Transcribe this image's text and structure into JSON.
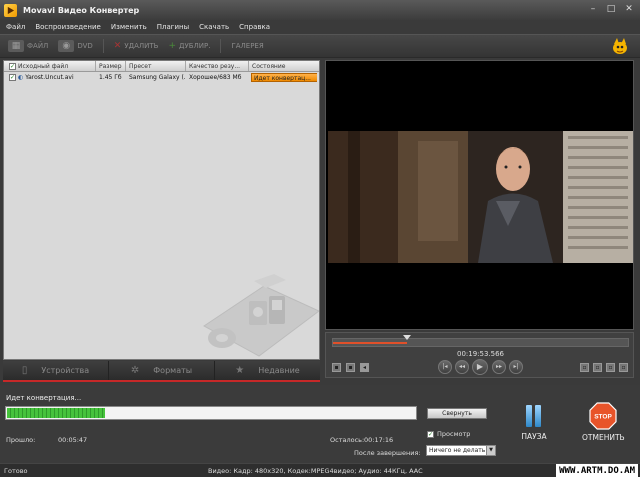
{
  "window": {
    "title": "Movavi Видео Конвертер"
  },
  "menu": [
    "Файл",
    "Воспроизведение",
    "Изменить",
    "Плагины",
    "Скачать",
    "Справка"
  ],
  "toolbar": {
    "file": "ФАЙЛ",
    "dvd": "DVD",
    "delete": "УДАЛИТЬ",
    "duplicate": "ДУБЛИР.",
    "gallery": "ГАЛЕРЕЯ"
  },
  "filelist": {
    "columns": [
      "Исходный файл",
      "Размер",
      "Пресет",
      "Качество резу...",
      "Состояние"
    ],
    "rows": [
      {
        "file": "Yarost.Uncut.avi",
        "size": "1.45 Гб",
        "preset": "Samsung Galaxy (...",
        "quality": "Хорошее/683 Мб",
        "status": "Идет конвертац..."
      }
    ]
  },
  "tabs": [
    "Устройства",
    "Форматы",
    "Недавние"
  ],
  "player": {
    "timecode": "00:19:53.566",
    "position": 0.25
  },
  "conversion": {
    "label": "Идет конвертация...",
    "progress": 0.24,
    "collapse": "Свернуть",
    "elapsed_label": "Прошло:",
    "elapsed_value": "00:05:47",
    "remaining_label": "Осталось:",
    "remaining_value": "00:17:16",
    "preview_label": "Просмотр",
    "after_label": "После завершения:",
    "after_value": "Ничего не делать",
    "pause": "ПАУЗА",
    "cancel": "ОТМЕНИТЬ",
    "stop_sign": "STOP"
  },
  "statusbar": {
    "status": "Готово",
    "info": "Видео: Кадр: 480x320, Кодек:MPEG4видео; Аудио: 44КГц, AAC",
    "watermark": "WWW.ARTM.DO.AM"
  }
}
